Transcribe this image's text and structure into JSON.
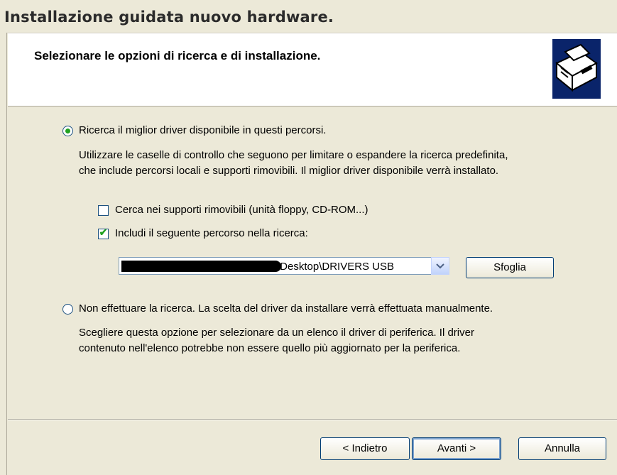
{
  "window": {
    "title": "Installazione guidata nuovo hardware."
  },
  "header": {
    "heading": "Selezionare le opzioni di ricerca e di installazione.",
    "icon": "hardware-wizard-icon"
  },
  "options": {
    "search_radio_label": "Ricerca il miglior driver disponibile in questi percorsi.",
    "search_desc_1": "Utilizzare le caselle di controllo che seguono per limitare o espandere la ricerca predefinita,",
    "search_desc_2": "che include percorsi locali e supporti rimovibili. Il miglior driver disponibile verrà installato.",
    "removable_label": "Cerca nei supporti rimovibili (unità floppy, CD-ROM...)",
    "removable_checked": false,
    "include_path_label": "Includi il seguente percorso nella ricerca:",
    "include_path_checked": true,
    "path_value": "\\Desktop\\DRIVERS USB",
    "browse_label": "Sfoglia",
    "manual_radio_label": "Non effettuare la ricerca. La scelta del driver da installare verrà effettuata manualmente.",
    "manual_desc_1": "Scegliere questa opzione per selezionare da un elenco il driver di periferica. Il driver",
    "manual_desc_2": "contenuto nell'elenco potrebbe non essere quello più aggiornato per la periferica.",
    "selected": "search"
  },
  "footer": {
    "back_label": "< Indietro",
    "next_label": "Avanti >",
    "cancel_label": "Annulla"
  },
  "colors": {
    "face": "#ece9d8",
    "header_bg": "#ffffff",
    "check_green": "#21a121",
    "control_border": "#1c5180",
    "icon_bg": "#0a246a"
  }
}
